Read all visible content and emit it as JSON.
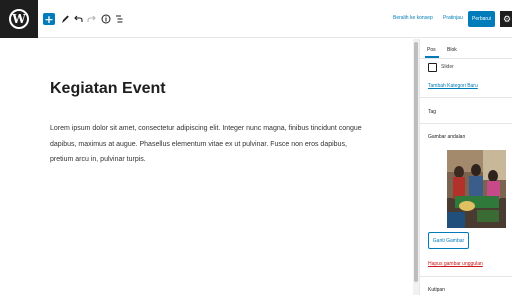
{
  "toolbar": {
    "logo_letter": "W",
    "add_symbol": "+",
    "switch_draft_label": "Beralih ke konsep",
    "preview_label": "Pratinjau",
    "publish_label": "Perbarui",
    "settings_symbol": "⚙"
  },
  "icons": {
    "add": "plus-icon",
    "tools": "pencil-icon",
    "undo": "undo-icon",
    "redo": "redo-icon",
    "details": "info-icon",
    "outline": "list-view-icon",
    "settings": "gear-icon"
  },
  "post": {
    "title": "Kegiatan Event",
    "body": "Lorem ipsum dolor sit amet, consectetur adipiscing elit. Integer nunc magna, finibus tincidunt congue dapibus, maximus at augue. Phasellus elementum vitae ex ut pulvinar. Fusce non eros dapibus, pretium arcu in, pulvinar turpis."
  },
  "sidebar": {
    "tabs": [
      {
        "label": "Pos",
        "active": true
      },
      {
        "label": "Blok",
        "active": false
      }
    ],
    "category_checkbox_label": "Slider",
    "add_category_link": "Tambah Kategori Baru",
    "tags_label": "Tag",
    "featured_image_label": "Gambar andalan",
    "replace_image_button": "Ganti Gambar",
    "remove_image_link": "Hapus gambar unggulan",
    "excerpt_label": "Kutipan"
  },
  "colors": {
    "accent": "#007cba",
    "dark": "#1e1e1e",
    "danger": "#cc1818"
  }
}
